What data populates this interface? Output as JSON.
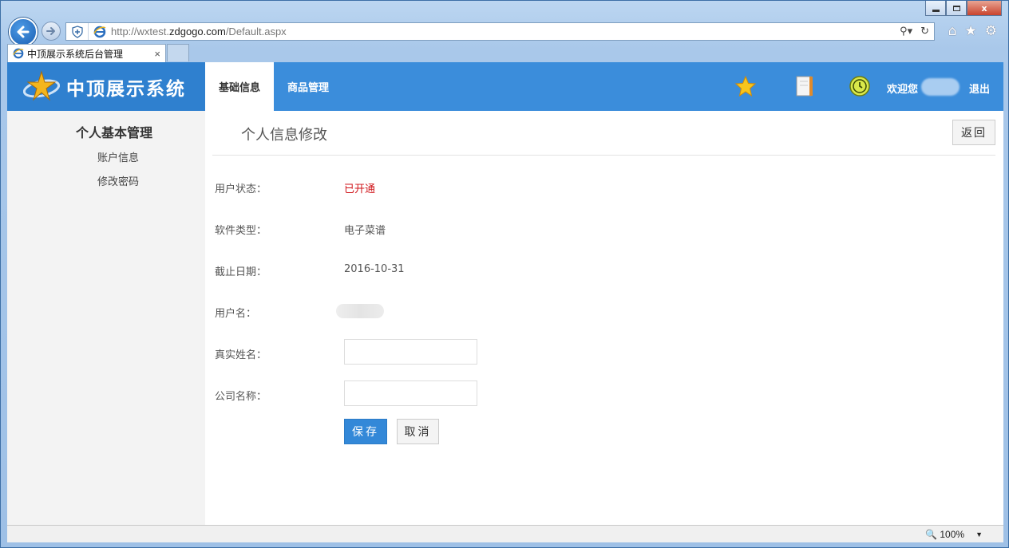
{
  "browser": {
    "url_prefix": "http://wxtest.",
    "url_domain": "zdgogo.com",
    "url_path": "/Default.aspx",
    "tab_title": "中顶展示系统后台管理",
    "tab_close": "×",
    "zoom": "100%",
    "window_close": "x"
  },
  "header": {
    "logo_title": "中顶展示系统",
    "nav": [
      {
        "label": "基础信息",
        "active": true
      },
      {
        "label": "商品管理",
        "active": false
      }
    ],
    "welcome": "欢迎您",
    "logout": "退出"
  },
  "sidebar": {
    "title": "个人基本管理",
    "links": [
      "账户信息",
      "修改密码"
    ]
  },
  "main": {
    "title": "个人信息修改",
    "back_label": "返回",
    "fields": {
      "status_label": "用户状态：",
      "status_value": "已开通",
      "type_label": "软件类型：",
      "type_value": "电子菜谱",
      "expiry_label": "截止日期：",
      "expiry_value": "2016-10-31",
      "username_label": "用户名：",
      "realname_label": "真实姓名：",
      "realname_value": "",
      "company_label": "公司名称：",
      "company_value": ""
    },
    "save_label": "保存",
    "cancel_label": "取消"
  },
  "colors": {
    "header_blue": "#3b8ddb",
    "status_red": "#d0161b",
    "save_blue": "#3388d8"
  }
}
